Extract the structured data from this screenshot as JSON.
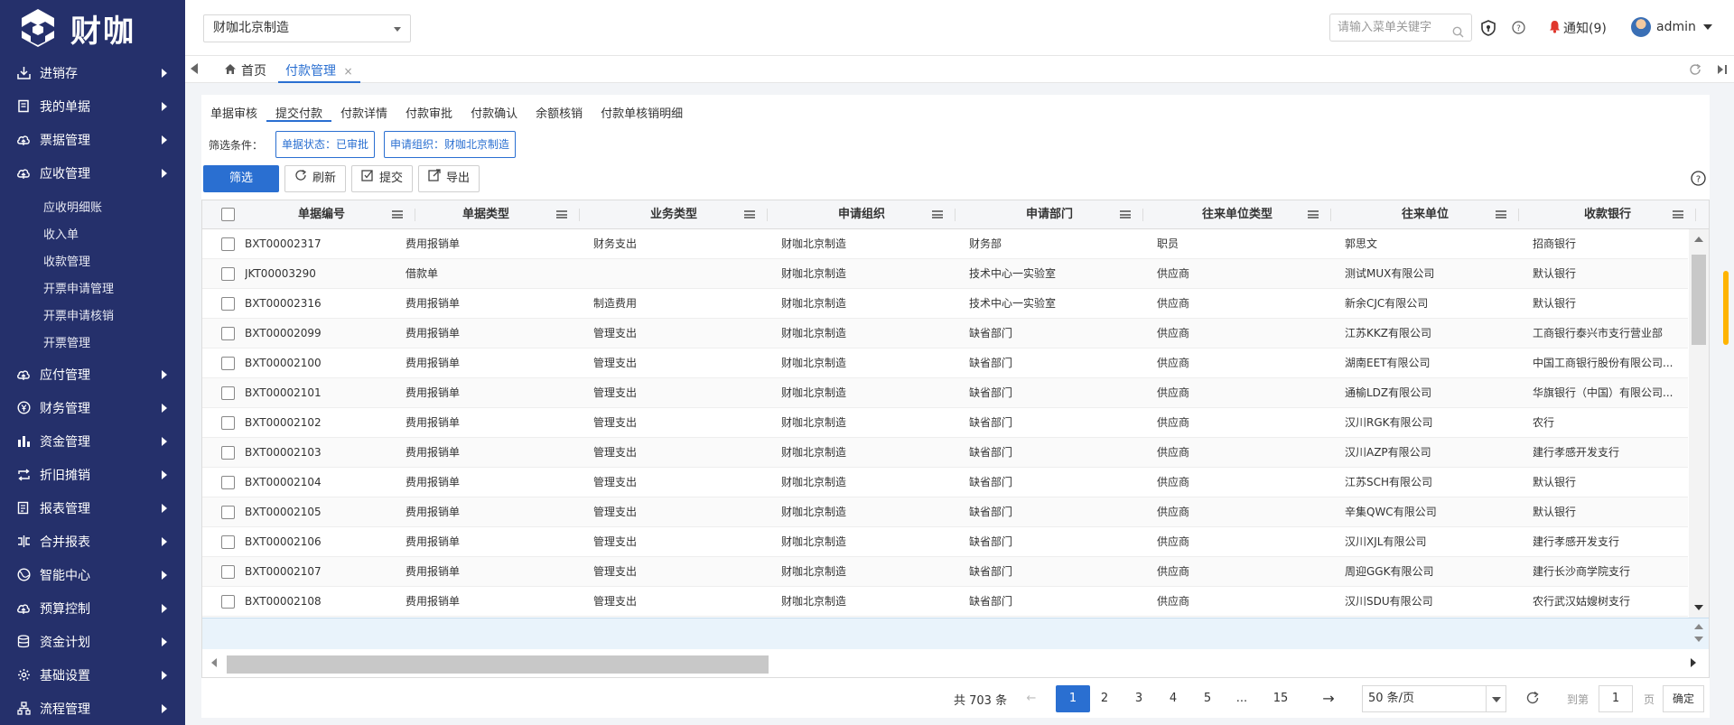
{
  "logo": {
    "text": "财咖"
  },
  "sidebar": {
    "items": [
      {
        "label": "进销存",
        "icon": "download-icon"
      },
      {
        "label": "我的单据",
        "icon": "document-icon"
      },
      {
        "label": "票据管理",
        "icon": "cloud-icon"
      },
      {
        "label": "应收管理",
        "icon": "cloud-icon"
      }
    ],
    "subitems": [
      "应收明细账",
      "收入单",
      "收款管理",
      "开票申请管理",
      "开票申请核销",
      "开票管理"
    ],
    "items_after": [
      {
        "label": "应付管理",
        "icon": "cloud-icon"
      },
      {
        "label": "财务管理",
        "icon": "coin-icon"
      },
      {
        "label": "资金管理",
        "icon": "bar-chart-icon"
      },
      {
        "label": "折旧摊销",
        "icon": "cycle-icon"
      },
      {
        "label": "报表管理",
        "icon": "report-icon"
      },
      {
        "label": "合并报表",
        "icon": "merge-icon"
      },
      {
        "label": "智能中心",
        "icon": "globe-icon"
      },
      {
        "label": "预算控制",
        "icon": "cloud-icon"
      },
      {
        "label": "资金计划",
        "icon": "database-icon"
      },
      {
        "label": "基础设置",
        "icon": "gear-icon"
      },
      {
        "label": "流程管理",
        "icon": "flow-icon"
      }
    ]
  },
  "header": {
    "org": "财咖北京制造",
    "search_placeholder": "请输入菜单关键字",
    "notice": "通知(9)",
    "user": "admin"
  },
  "tabs": {
    "home": "首页",
    "active": "付款管理",
    "close": "×"
  },
  "subtabs": [
    "单据审核",
    "提交付款",
    "付款详情",
    "付款审批",
    "付款确认",
    "余额核销",
    "付款单核销明细"
  ],
  "active_subtab": 1,
  "filter": {
    "label": "筛选条件：",
    "chips": [
      "单据状态：已审批",
      "申请组织：财咖北京制造"
    ]
  },
  "toolbar": {
    "filter": "筛选",
    "refresh": "刷新",
    "submit": "提交",
    "export": "导出"
  },
  "table": {
    "columns": [
      "单据编号",
      "单据类型",
      "业务类型",
      "申请组织",
      "申请部门",
      "往来单位类型",
      "往来单位",
      "收款银行"
    ],
    "rows": [
      [
        "BXT00002317",
        "费用报销单",
        "财务支出",
        "财咖北京制造",
        "财务部",
        "职员",
        "郭思文",
        "招商银行"
      ],
      [
        "JKT00003290",
        "借款单",
        "",
        "财咖北京制造",
        "技术中心一实验室",
        "供应商",
        "测试MUX有限公司",
        "默认银行"
      ],
      [
        "BXT00002316",
        "费用报销单",
        "制造费用",
        "财咖北京制造",
        "技术中心一实验室",
        "供应商",
        "新余CJC有限公司",
        "默认银行"
      ],
      [
        "BXT00002099",
        "费用报销单",
        "管理支出",
        "财咖北京制造",
        "缺省部门",
        "供应商",
        "江苏KKZ有限公司",
        "工商银行泰兴市支行营业部"
      ],
      [
        "BXT00002100",
        "费用报销单",
        "管理支出",
        "财咖北京制造",
        "缺省部门",
        "供应商",
        "湖南EET有限公司",
        "中国工商银行股份有限公司..."
      ],
      [
        "BXT00002101",
        "费用报销单",
        "管理支出",
        "财咖北京制造",
        "缺省部门",
        "供应商",
        "通榆LDZ有限公司",
        "华旗银行（中国）有限公司..."
      ],
      [
        "BXT00002102",
        "费用报销单",
        "管理支出",
        "财咖北京制造",
        "缺省部门",
        "供应商",
        "汉川RGK有限公司",
        "农行"
      ],
      [
        "BXT00002103",
        "费用报销单",
        "管理支出",
        "财咖北京制造",
        "缺省部门",
        "供应商",
        "汉川AZP有限公司",
        "建行孝感开发支行"
      ],
      [
        "BXT00002104",
        "费用报销单",
        "管理支出",
        "财咖北京制造",
        "缺省部门",
        "供应商",
        "江苏SCH有限公司",
        "默认银行"
      ],
      [
        "BXT00002105",
        "费用报销单",
        "管理支出",
        "财咖北京制造",
        "缺省部门",
        "供应商",
        "辛集QWC有限公司",
        "默认银行"
      ],
      [
        "BXT00002106",
        "费用报销单",
        "管理支出",
        "财咖北京制造",
        "缺省部门",
        "供应商",
        "汉川XJL有限公司",
        "建行孝感开发支行"
      ],
      [
        "BXT00002107",
        "费用报销单",
        "管理支出",
        "财咖北京制造",
        "缺省部门",
        "供应商",
        "周迎GGK有限公司",
        "建行长沙商学院支行"
      ],
      [
        "BXT00002108",
        "费用报销单",
        "管理支出",
        "财咖北京制造",
        "缺省部门",
        "供应商",
        "汉川SDU有限公司",
        "农行武汉姑嫂树支行"
      ]
    ]
  },
  "pager": {
    "total": "共 703 条",
    "prev": "←",
    "next": "→",
    "pages": [
      "1",
      "2",
      "3",
      "4",
      "5",
      "...",
      "15"
    ],
    "current": "1",
    "size": "50 条/页",
    "goto_prefix": "到第",
    "goto_value": "1",
    "goto_suffix": "页",
    "confirm": "确定"
  },
  "colors": {
    "sidebar": "#25306b",
    "accent": "#2a6fd1",
    "notice": "#e0362c"
  }
}
